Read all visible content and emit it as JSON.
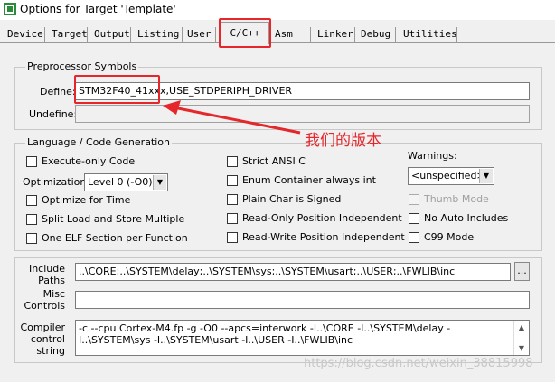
{
  "window": {
    "title": "Options for Target 'Template'"
  },
  "tabs": [
    "Device",
    "Target",
    "Output",
    "Listing",
    "User",
    "C/C++",
    "Asm",
    "Linker",
    "Debug",
    "Utilities"
  ],
  "active_tab": "C/C++",
  "preprocessor": {
    "group_title": "Preprocessor Symbols",
    "define_label": "Define:",
    "define_value": "STM32F40_41xxx,USE_STDPERIPH_DRIVER",
    "undefine_label": "Undefine:",
    "undefine_value": ""
  },
  "annotation": {
    "text": "我们的版本",
    "color": "#e5262b"
  },
  "language": {
    "group_title": "Language / Code Generation",
    "execute_only": "Execute-only Code",
    "optimization_label": "Optimization:",
    "optimization_value": "Level 0 (-O0)",
    "optimize_time": "Optimize for Time",
    "split_load": "Split Load and Store Multiple",
    "one_elf": "One ELF Section per Function",
    "strict_ansi": "Strict ANSI C",
    "enum_container": "Enum Container always int",
    "plain_char": "Plain Char is Signed",
    "ro_pos": "Read-Only Position Independent",
    "rw_pos": "Read-Write Position Independent",
    "warnings_label": "Warnings:",
    "warnings_value": "<unspecified>",
    "thumb_mode": "Thumb Mode",
    "no_auto_includes": "No Auto Includes",
    "c99_mode": "C99 Mode"
  },
  "paths": {
    "include_label_1": "Include",
    "include_label_2": "Paths",
    "include_value": "..\\CORE;..\\SYSTEM\\delay;..\\SYSTEM\\sys;..\\SYSTEM\\usart;..\\USER;..\\FWLIB\\inc",
    "browse_label": "...",
    "misc_label_1": "Misc",
    "misc_label_2": "Controls",
    "misc_value": "",
    "compiler_label_1": "Compiler",
    "compiler_label_2": "control",
    "compiler_label_3": "string",
    "compiler_value": "-c --cpu Cortex-M4.fp -g -O0 --apcs=interwork -I..\\CORE -I..\\SYSTEM\\delay -I..\\SYSTEM\\sys -I..\\SYSTEM\\usart -I..\\USER -I..\\FWLIB\\inc"
  },
  "watermark": "https://blog.csdn.net/weixin_38815998"
}
